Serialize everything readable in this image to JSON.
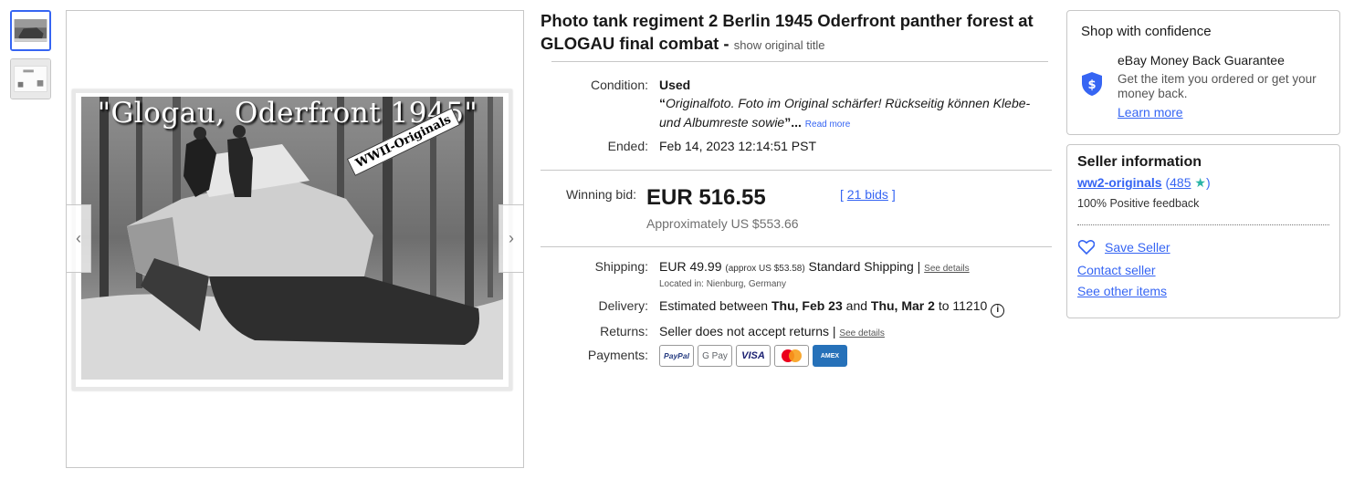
{
  "gallery": {
    "thumbnails": [
      {
        "alt": "thumbnail-1",
        "active": true
      },
      {
        "alt": "thumbnail-2",
        "active": false
      }
    ],
    "photo_caption": "\"Glogau, Oderfront 1945\"",
    "photo_stamp": "WWII-Originals",
    "prev_icon": "chevron-left-icon",
    "next_icon": "chevron-right-icon"
  },
  "listing": {
    "title": "Photo tank regiment 2 Berlin 1945 Oderfront panther forest at GLOGAU final combat -",
    "show_original": "show original title",
    "condition_label": "Condition:",
    "condition_value": "Used",
    "condition_note": "Originalfoto. Foto im Original schärfer! Rückseitig können Klebe- und Albumreste sowie",
    "read_more": "Read more",
    "ended_label": "Ended:",
    "ended_value": "Feb 14, 2023 12:14:51 PST",
    "winning_bid_label": "Winning bid:",
    "winning_bid": "EUR 516.55",
    "approx_price": "Approximately US $553.66",
    "bids": "21 bids",
    "shipping_label": "Shipping:",
    "shipping_price": "EUR 49.99",
    "shipping_approx": "(approx US $53.58)",
    "shipping_method": "Standard Shipping",
    "see_details": "See details",
    "location": "Located in: Nienburg, Germany",
    "delivery_label": "Delivery:",
    "delivery_prefix": "Estimated between",
    "delivery_from": "Thu, Feb 23",
    "delivery_and": "and",
    "delivery_to": "Thu, Mar 2",
    "delivery_zip_prefix": "to",
    "delivery_zip": "11210",
    "returns_label": "Returns:",
    "returns_value": "Seller does not accept returns",
    "returns_details": "See details",
    "payments_label": "Payments:",
    "payments": [
      "PayPal",
      "G Pay",
      "VISA",
      "mastercard",
      "AMEX"
    ]
  },
  "confidence": {
    "title": "Shop with confidence",
    "guarantee_title": "eBay Money Back Guarantee",
    "guarantee_desc": "Get the item you ordered or get your money back.",
    "learn_more": "Learn more"
  },
  "seller": {
    "title": "Seller information",
    "name": "ww2-originals",
    "score": "485",
    "feedback": "100% Positive feedback",
    "save_seller": "Save Seller",
    "contact_seller": "Contact seller",
    "see_other_items": "See other items"
  },
  "colors": {
    "link": "#3665f3",
    "star": "#2bb4a6",
    "shield": "#3665f3"
  }
}
